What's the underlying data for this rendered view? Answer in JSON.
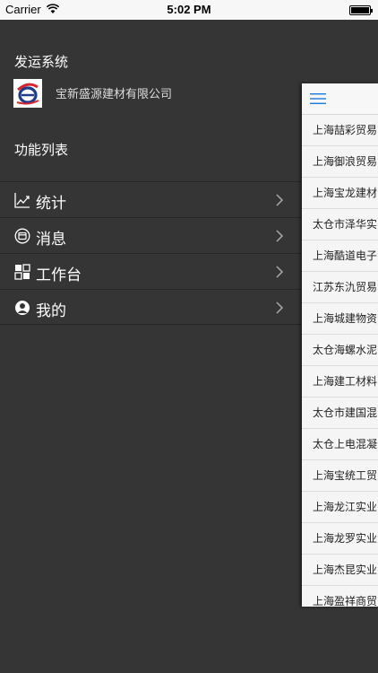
{
  "status_bar": {
    "carrier": "Carrier",
    "time": "5:02 PM"
  },
  "menu": {
    "app_title": "发运系统",
    "company": "宝新盛源建材有限公司",
    "section_title": "功能列表",
    "items": [
      {
        "label": "统计",
        "icon": "chart-line-icon"
      },
      {
        "label": "消息",
        "icon": "message-icon"
      },
      {
        "label": "工作台",
        "icon": "grid-icon"
      },
      {
        "label": "我的",
        "icon": "user-icon"
      }
    ]
  },
  "main": {
    "list": [
      "上海喆彩贸易",
      "上海御浪贸易",
      "上海宝龙建材",
      "太仓市泽华实",
      "上海酷道电子",
      "江苏东氿贸易",
      "上海城建物资",
      "太仓海螺水泥",
      "上海建工材料",
      "太仓市建国混",
      "太仓上电混凝",
      "上海宝统工贸",
      "上海龙江实业",
      "上海龙罗实业",
      "上海杰昆实业",
      "上海盈祥商贸"
    ]
  },
  "colors": {
    "menu_bg": "#353535",
    "accent_blue": "#1a7ad9",
    "logo_blue": "#1f3b8a",
    "logo_red": "#d9252b"
  }
}
